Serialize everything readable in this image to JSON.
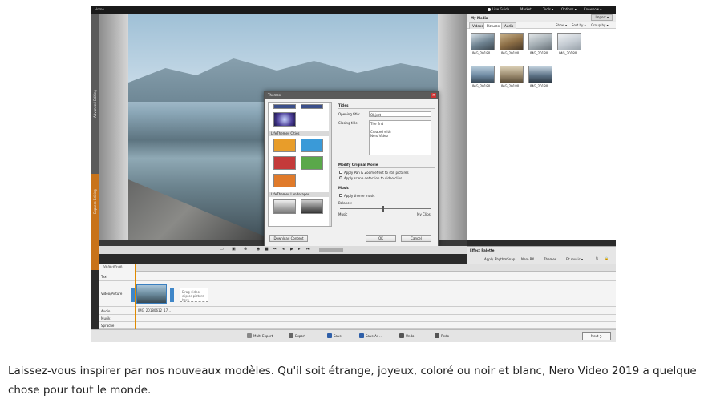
{
  "window": {
    "title": "Home",
    "menus": [
      "Live Guide",
      "Market",
      "Tools ▾",
      "Options ▾",
      "Knowhow ▾"
    ]
  },
  "side_tabs": {
    "advanced": "Advanced Editing",
    "express": "Express Editing"
  },
  "media": {
    "title": "My Media",
    "import_label": "Import ▾",
    "tabs": [
      "Videos",
      "Pictures",
      "Audio"
    ],
    "controls": [
      "Show ▾",
      "Sort by ▾",
      "Group by ▾"
    ],
    "thumbnails": [
      {
        "label": "IMG_20180...",
        "color": "#7a8d99"
      },
      {
        "label": "IMG_20180...",
        "color": "#8c7a5a"
      },
      {
        "label": "IMG_20180...",
        "color": "#a9b4bb"
      },
      {
        "label": "IMG_20180...",
        "color": "#c5ccd3"
      },
      {
        "label": "IMG_20180...",
        "color": "#6f8aa3"
      },
      {
        "label": "IMG_20180...",
        "color": "#9a8a6e"
      },
      {
        "label": "IMG_20180...",
        "color": "#5e7488"
      }
    ]
  },
  "dialog": {
    "title": "Themes",
    "categories": [
      "LifeThemes Cities",
      "LifeThemes Landscapes"
    ],
    "titles_header": "Titles",
    "opening_label": "Opening title:",
    "opening_value": "Object",
    "closing_label": "Closing title:",
    "closing_value": "The End\n\nCreated with\nNero Video",
    "modify_header": "Modify Original Movie",
    "modify_opt1": "Apply Pan & Zoom effect to still pictures",
    "modify_opt2": "Apply scene detection to video clips",
    "music_header": "Music",
    "music_opt": "Apply theme music",
    "balance_label": "Balance:",
    "balance_left": "Music",
    "balance_right": "My Clips",
    "download_label": "Download Content",
    "ok_label": "OK",
    "cancel_label": "Cancel"
  },
  "effects": {
    "title": "Effect Palette",
    "items": [
      "Apply RhythmSnap",
      "Nero RX",
      "Themes",
      "Fit music ▾"
    ]
  },
  "timeline": {
    "time": "00:00:00:00",
    "tracks": [
      "Text",
      "Video/Picture",
      "Audio",
      "Musik",
      "Sprache"
    ],
    "clip_label": "IMG_20180612_17...",
    "drop_text": "Drag video clip or picture here"
  },
  "actions": [
    "Multi Export",
    "Export",
    "Save",
    "Save As ...",
    "Undo",
    "Redo"
  ],
  "next_label": "Next ❯",
  "caption": "Laissez-vous inspirer par nos nouveaux modèles. Qu'il soit étrange, joyeux, coloré ou noir et blanc, Nero Video 2019 a quelque chose pour tout le monde."
}
